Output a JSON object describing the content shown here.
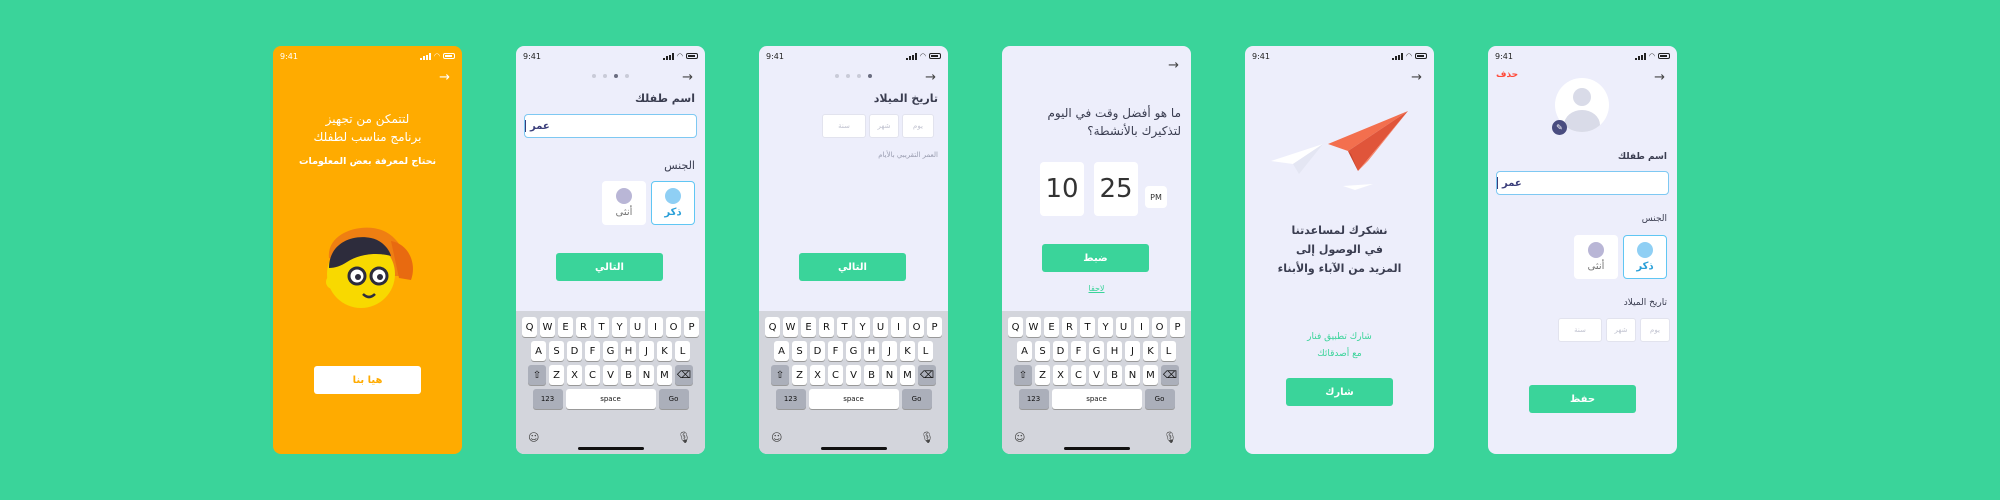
{
  "status_time": "9:41",
  "colors": {
    "background": "#3ad49a",
    "orange": "#ffab00",
    "accent": "#3ad49a",
    "delete": "#ff4a3a"
  },
  "screen1": {
    "title_line1": "لتتمكن من تجهيز",
    "title_line2": "برنامج مناسب لطفلك",
    "subtitle": "نحتاج لمعرفة بعض المعلومات",
    "start_button": "هيا بنا"
  },
  "screen2": {
    "name_label": "اسم طفلك",
    "name_value": "عمر",
    "gender_label": "الجنس",
    "male": "ذكر",
    "female": "أنثى",
    "next_button": "التالي"
  },
  "screen3": {
    "dob_label": "تاريخ الميلاد",
    "day_placeholder": "يوم",
    "month_placeholder": "شهر",
    "year_placeholder": "سنة",
    "approx_age": "العمر التقريبي بالأيام",
    "next_button": "التالي"
  },
  "screen4": {
    "question_line1": "ما هو أفضل وقت في اليوم",
    "question_line2": "لتذكيرك بالأنشطة؟",
    "hour": "10",
    "minute": "25",
    "period": "PM",
    "set_button": "ضبط",
    "later_link": "لاحقا"
  },
  "screen5": {
    "thanks_line1": "نشكرك لمساعدتنا",
    "thanks_line2": "في الوصول إلى",
    "thanks_line3": "المزيد من الآباء والأبناء",
    "share_line1": "شارك تطبيق فنار",
    "share_line2": "مع أصدقائك",
    "share_button": "شارك"
  },
  "screen6": {
    "delete_link": "حذف",
    "name_label": "اسم طفلك",
    "name_value": "عمر",
    "gender_label": "الجنس",
    "male": "ذكر",
    "female": "أنثى",
    "dob_label": "تاريخ الميلاد",
    "day_placeholder": "يوم",
    "month_placeholder": "شهر",
    "year_placeholder": "سنة",
    "save_button": "حفظ"
  },
  "keyboard": {
    "row1": [
      "Q",
      "W",
      "E",
      "R",
      "T",
      "Y",
      "U",
      "I",
      "O",
      "P"
    ],
    "row2": [
      "A",
      "S",
      "D",
      "F",
      "G",
      "H",
      "J",
      "K",
      "L"
    ],
    "row3": [
      "Z",
      "X",
      "C",
      "V",
      "B",
      "N",
      "M"
    ],
    "num_key": "123",
    "space_key": "space",
    "go_key": "Go"
  }
}
